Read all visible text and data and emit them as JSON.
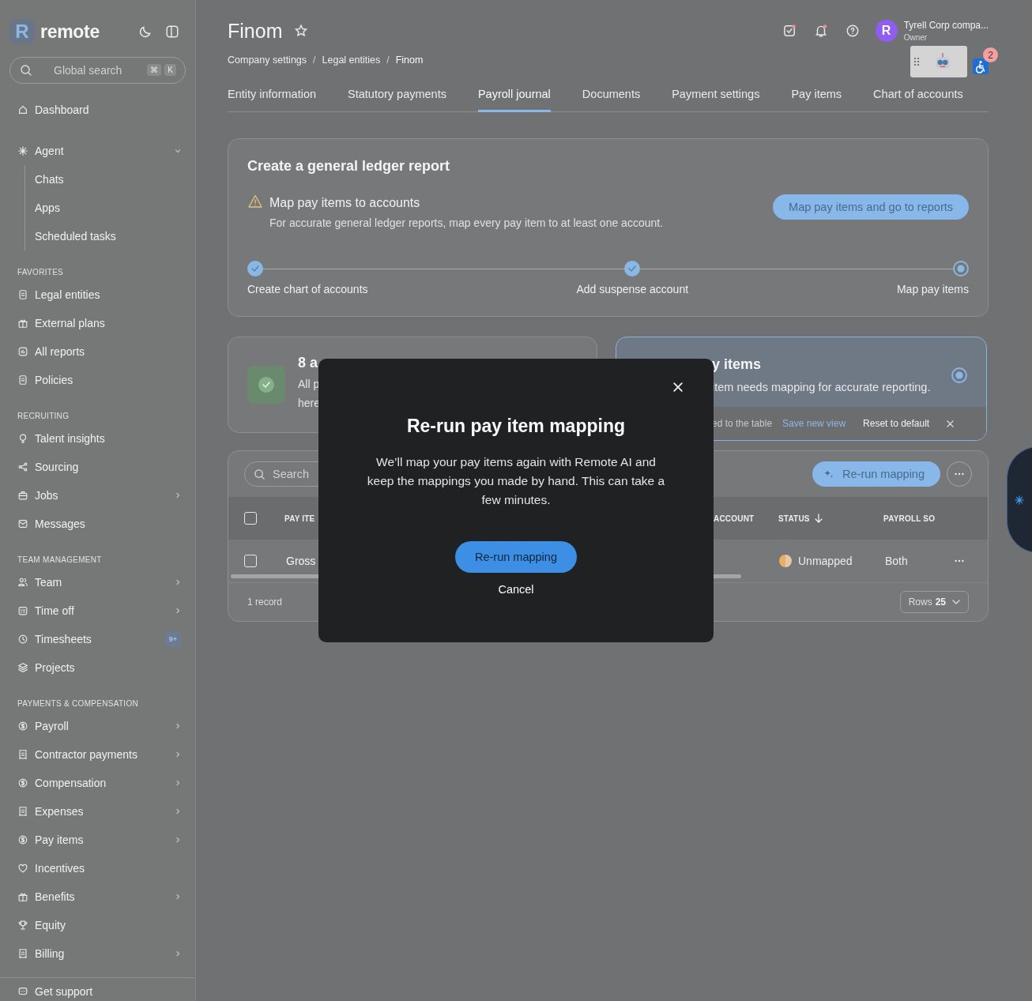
{
  "sidebar": {
    "logo_mark": "R",
    "logo_text": "remote",
    "search": {
      "placeholder": "Global search",
      "keys": [
        "⌘",
        "K"
      ]
    },
    "sections": [
      {
        "items": [
          {
            "label": "Dashboard",
            "expandable": false,
            "expanded": false
          }
        ]
      },
      {
        "items": [
          {
            "label": "Agent",
            "expandable": true,
            "expanded": true,
            "children": [
              {
                "label": "Chats"
              },
              {
                "label": "Apps"
              },
              {
                "label": "Scheduled tasks"
              }
            ]
          }
        ]
      },
      {
        "heading": "FAVORITES",
        "items": [
          {
            "label": "Legal entities",
            "expandable": false,
            "expanded": false
          },
          {
            "label": "External plans",
            "expandable": false,
            "expanded": false
          },
          {
            "label": "All reports",
            "expandable": false,
            "expanded": false
          },
          {
            "label": "Policies",
            "expandable": false,
            "expanded": false
          }
        ]
      },
      {
        "heading": "RECRUITING",
        "items": [
          {
            "label": "Talent insights",
            "expandable": false,
            "expanded": false
          },
          {
            "label": "Sourcing",
            "expandable": false,
            "expanded": false
          },
          {
            "label": "Jobs",
            "expandable": true,
            "expanded": false
          },
          {
            "label": "Messages",
            "expandable": false,
            "expanded": false
          }
        ]
      },
      {
        "heading": "TEAM MANAGEMENT",
        "items": [
          {
            "label": "Team",
            "expandable": true,
            "expanded": false
          },
          {
            "label": "Time off",
            "expandable": true,
            "expanded": false
          },
          {
            "label": "Timesheets",
            "expandable": false,
            "expanded": false,
            "badge": "9+"
          },
          {
            "label": "Projects",
            "expandable": false,
            "expanded": false
          }
        ]
      },
      {
        "heading": "PAYMENTS & COMPENSATION",
        "items": [
          {
            "label": "Payroll",
            "expandable": true,
            "expanded": false
          },
          {
            "label": "Contractor payments",
            "expandable": true,
            "expanded": false
          },
          {
            "label": "Compensation",
            "expandable": true,
            "expanded": false
          },
          {
            "label": "Expenses",
            "expandable": true,
            "expanded": false
          },
          {
            "label": "Pay items",
            "expandable": true,
            "expanded": false
          },
          {
            "label": "Incentives",
            "expandable": false,
            "expanded": false
          },
          {
            "label": "Benefits",
            "expandable": true,
            "expanded": false
          },
          {
            "label": "Equity",
            "expandable": false,
            "expanded": false
          },
          {
            "label": "Billing",
            "expandable": true,
            "expanded": false
          }
        ]
      }
    ],
    "footer": "Get support"
  },
  "header": {
    "title": "Finom",
    "user": {
      "initial": "R",
      "name": "Tyrell Corp compa...",
      "role": "Owner"
    },
    "widget_badge": "2"
  },
  "breadcrumbs": [
    "Company settings",
    "Legal entities",
    "Finom"
  ],
  "breadcrumb_separator": "/",
  "tabs": [
    {
      "label": "Entity information",
      "selected": false
    },
    {
      "label": "Statutory payments",
      "selected": false
    },
    {
      "label": "Payroll journal",
      "selected": true
    },
    {
      "label": "Documents",
      "selected": false
    },
    {
      "label": "Payment settings",
      "selected": false
    },
    {
      "label": "Pay items",
      "selected": false
    },
    {
      "label": "Chart of accounts",
      "selected": false
    }
  ],
  "ledger_card": {
    "title": "Create a general ledger report",
    "warning_title": "Map pay items to accounts",
    "warning_text": "For accurate general ledger reports, map every pay item to at least one account.",
    "button": "Map pay items and go to reports",
    "steps": [
      {
        "label": "Create chart of accounts",
        "completed": true,
        "selected": false
      },
      {
        "label": "Add suspense account",
        "completed": true,
        "selected": false
      },
      {
        "label": "Map pay items",
        "completed": false,
        "selected": true
      }
    ]
  },
  "accounts_card": {
    "title": "8 a",
    "text_lines": [
      "All p",
      "here"
    ]
  },
  "pay_items_card": {
    "title": "y items",
    "text": "item needs mapping for accurate reporting.",
    "selected": true,
    "notice": "ed to the table",
    "save_link": "Save new view",
    "reset": "Reset to default"
  },
  "table": {
    "search_placeholder": "Search",
    "all_checked": false,
    "rerun_button": "Re-run mapping",
    "columns": [
      {
        "label": "PAY ITE"
      },
      {
        "label": "ACCOUNT"
      },
      {
        "label": "STATUS",
        "sorted": true
      },
      {
        "label": "PAYROLL SO"
      }
    ],
    "rows": [
      {
        "pay_item": "Gross",
        "status": "Unmapped",
        "payroll_source": "Both",
        "checked": false
      }
    ],
    "footer": "1 record",
    "rows_label": "Rows",
    "rows_value": "25"
  },
  "modal": {
    "title": "Re-run pay item mapping",
    "text": "We’ll map your pay items again with Remote AI and keep the mappings you made by hand. This can take a few minutes.",
    "confirm": "Re-run mapping",
    "cancel": "Cancel"
  }
}
